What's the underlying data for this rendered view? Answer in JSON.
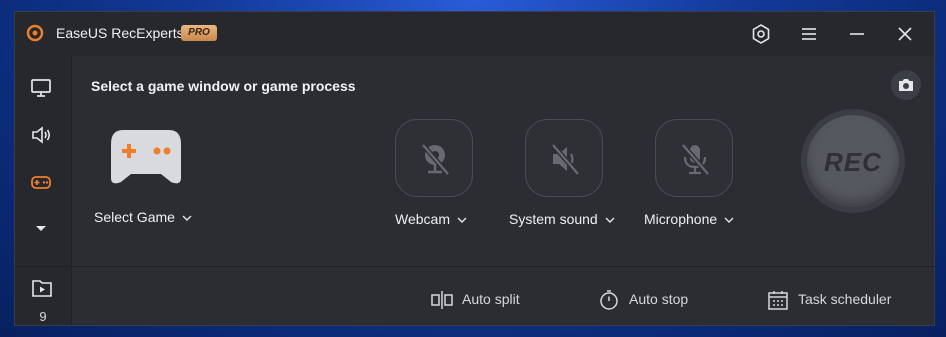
{
  "app": {
    "title": "EaseUS RecExperts",
    "badge": "PRO"
  },
  "titlebar": {
    "buttons": [
      {
        "name": "settings-icon"
      },
      {
        "name": "menu-icon"
      },
      {
        "name": "minimize-icon"
      },
      {
        "name": "close-icon"
      }
    ]
  },
  "sidebar": {
    "items": [
      {
        "name": "screen-icon"
      },
      {
        "name": "audio-icon"
      },
      {
        "name": "game-icon",
        "active": true
      },
      {
        "name": "more-chevron-icon"
      }
    ],
    "recordings_count": "9"
  },
  "main": {
    "heading": "Select a game window or game process",
    "select_game_label": "Select Game",
    "sources": [
      {
        "label": "Webcam",
        "state": "off"
      },
      {
        "label": "System sound",
        "state": "off"
      },
      {
        "label": "Microphone",
        "state": "off"
      }
    ],
    "rec_label": "REC"
  },
  "toolbar": {
    "auto_split": "Auto split",
    "auto_stop": "Auto stop",
    "task_scheduler": "Task scheduler"
  },
  "colors": {
    "accent": "#f07d2a",
    "window_bg": "#2b2d33",
    "panel_bg": "#26282d"
  }
}
